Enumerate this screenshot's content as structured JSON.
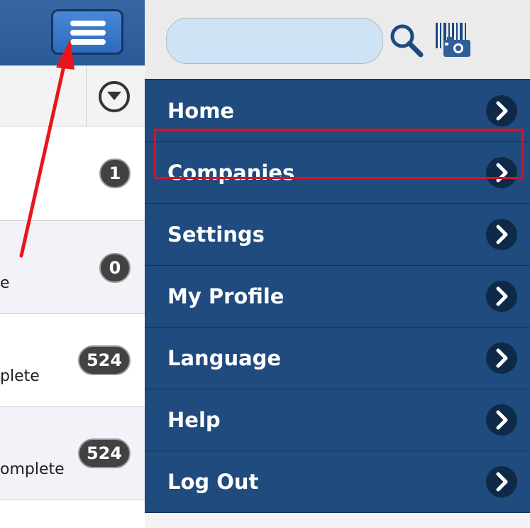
{
  "list": {
    "rows": [
      {
        "badge": "1",
        "subtext": ""
      },
      {
        "badge": "0",
        "subtext": "e"
      },
      {
        "badge": "524",
        "subtext": "plete"
      },
      {
        "badge": "524",
        "subtext": "omplete"
      }
    ]
  },
  "drawer": {
    "search": {
      "placeholder": "",
      "value": ""
    },
    "menu": [
      {
        "label": "Home"
      },
      {
        "label": "Companies"
      },
      {
        "label": "Settings"
      },
      {
        "label": "My Profile"
      },
      {
        "label": "Language"
      },
      {
        "label": "Help"
      },
      {
        "label": "Log Out"
      }
    ]
  },
  "icons": {
    "menu": "hamburger-menu-icon",
    "filter": "dropdown-circle-icon",
    "search": "search-icon",
    "scan": "barcode-camera-icon",
    "chevron": "chevron-right-icon"
  },
  "colors": {
    "drawer_item_bg": "#1f4b7e",
    "drawer_divider": "#12345a",
    "chevron_bg": "#0f2a48",
    "header_blue": "#2a5a97",
    "annotation_red": "#d3142a",
    "search_bg": "#cfe3f6"
  }
}
